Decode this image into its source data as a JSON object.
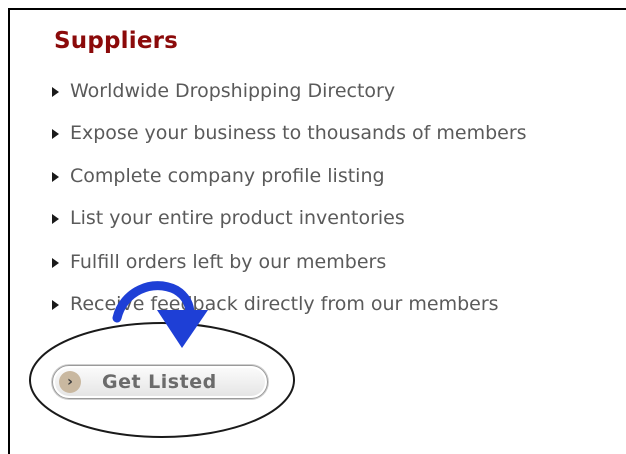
{
  "section": {
    "title": "Suppliers"
  },
  "features": [
    "Worldwide Dropshipping Directory",
    "Expose your business to thousands of members",
    "Complete company profile listing",
    "List your entire product inventories",
    "Fulfill orders left by our members",
    "Receive feedback directly from our members"
  ],
  "cta": {
    "label": "Get Listed",
    "icon": "chevron-right-icon"
  },
  "annotation": {
    "arrow_color": "#1e3fd6",
    "circle_color": "#1a1a1a"
  }
}
